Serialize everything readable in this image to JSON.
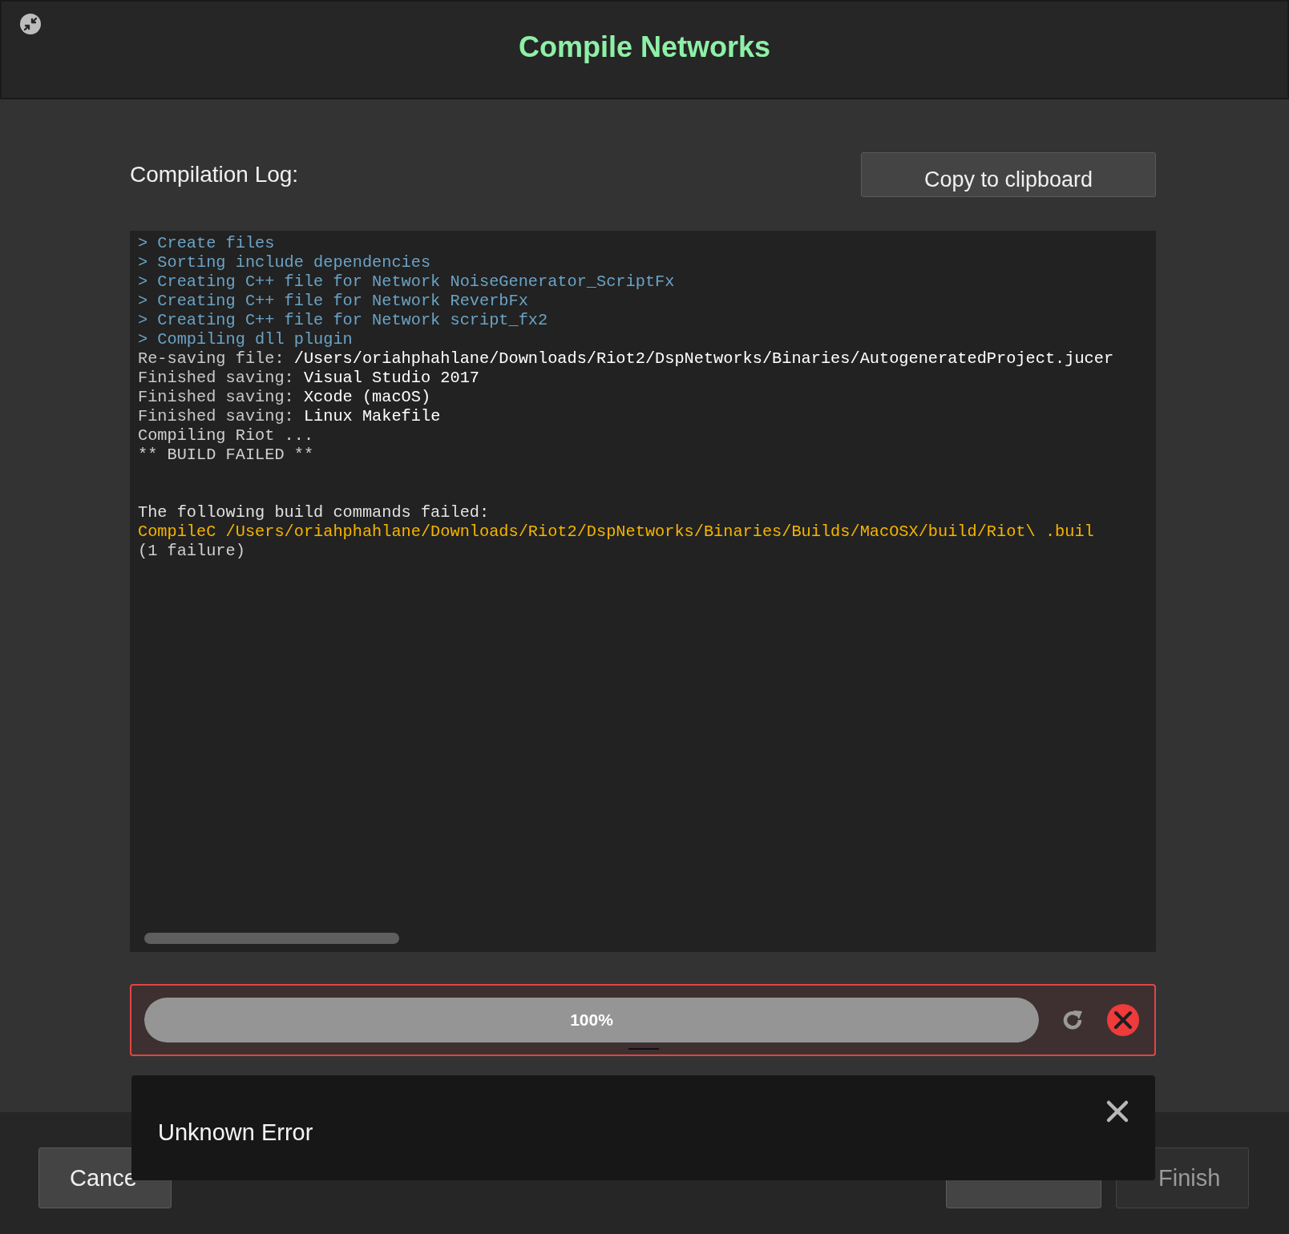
{
  "window": {
    "title": "Compile Networks"
  },
  "log": {
    "label": "Compilation Log:",
    "copy_button": "Copy to clipboard",
    "lines": [
      {
        "kind": "step",
        "prompt": ">",
        "text": "Create files"
      },
      {
        "kind": "step",
        "prompt": ">",
        "text": "Sorting include dependencies"
      },
      {
        "kind": "step",
        "prompt": ">",
        "text": "Creating C++ file for Network NoiseGenerator_ScriptFx"
      },
      {
        "kind": "step",
        "prompt": ">",
        "text": "Creating C++ file for Network ReverbFx"
      },
      {
        "kind": "step",
        "prompt": ">",
        "text": "Creating C++ file for Network script_fx2"
      },
      {
        "kind": "step",
        "prompt": ">",
        "text": "Compiling dll plugin"
      },
      {
        "kind": "info",
        "label": "Re-saving file:",
        "text": "/Users/oriahphahlane/Downloads/Riot2/DspNetworks/Binaries/AutogeneratedProject.jucer"
      },
      {
        "kind": "info",
        "label": "Finished saving:",
        "text": "Visual Studio 2017"
      },
      {
        "kind": "info",
        "label": "Finished saving:",
        "text": "Xcode (macOS)"
      },
      {
        "kind": "info",
        "label": "Finished saving:",
        "text": "Linux Makefile"
      },
      {
        "kind": "plain",
        "text": "Compiling Riot ..."
      },
      {
        "kind": "plain",
        "text": "** BUILD FAILED **"
      },
      {
        "kind": "heading",
        "text": "The following build commands failed:"
      },
      {
        "kind": "command",
        "text": "CompileC /Users/oriahphahlane/Downloads/Riot2/DspNetworks/Binaries/Builds/MacOSX/build/Riot\\ .buil"
      },
      {
        "kind": "plain",
        "text": "(1 failure)"
      }
    ]
  },
  "progress": {
    "level": 1.0,
    "text": "100%",
    "failed": true
  },
  "toast": {
    "message": "Unknown Error"
  },
  "left_buttons": [
    {
      "label": "Cance",
      "disabled": false
    }
  ],
  "right_buttons": [
    {
      "disabled": false
    },
    {
      "label": "Finish",
      "disabled": true
    }
  ]
}
